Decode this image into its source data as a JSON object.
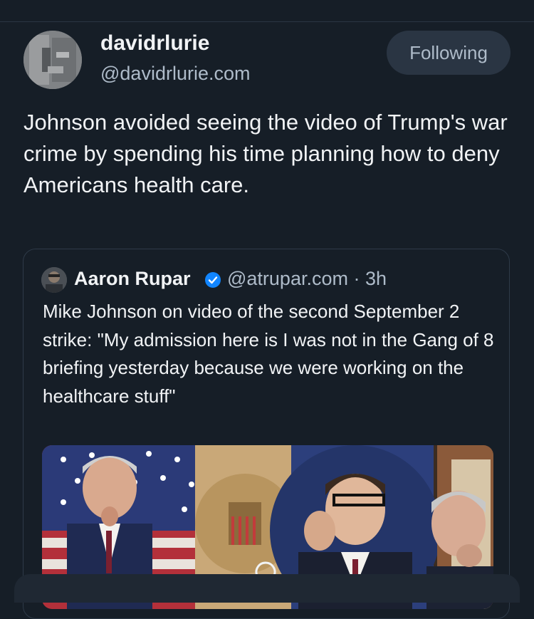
{
  "post": {
    "author": {
      "display_name": "davidrlurie",
      "handle": "@davidrlurie.com",
      "avatar_icon": "avatar-image"
    },
    "follow_label": "Following",
    "text": "Johnson avoided seeing the video of Trump's war crime by spending his time planning how to deny Americans health care."
  },
  "quote": {
    "author": {
      "display_name": "Aaron Rupar",
      "verified_icon": "verified-check-icon",
      "meta": "@atrupar.com · 3h"
    },
    "text": "Mike Johnson on video of the second September 2 strike: \"My admission here is I was not in the Gang of 8 briefing yesterday because we were working on the healthcare stuff\"",
    "media_icon": "video-thumbnail"
  },
  "colors": {
    "background": "#161e27",
    "text": "#f1f3f5",
    "muted": "#aebbc9",
    "button_bg": "#2a3543",
    "verified": "#1185fe"
  }
}
